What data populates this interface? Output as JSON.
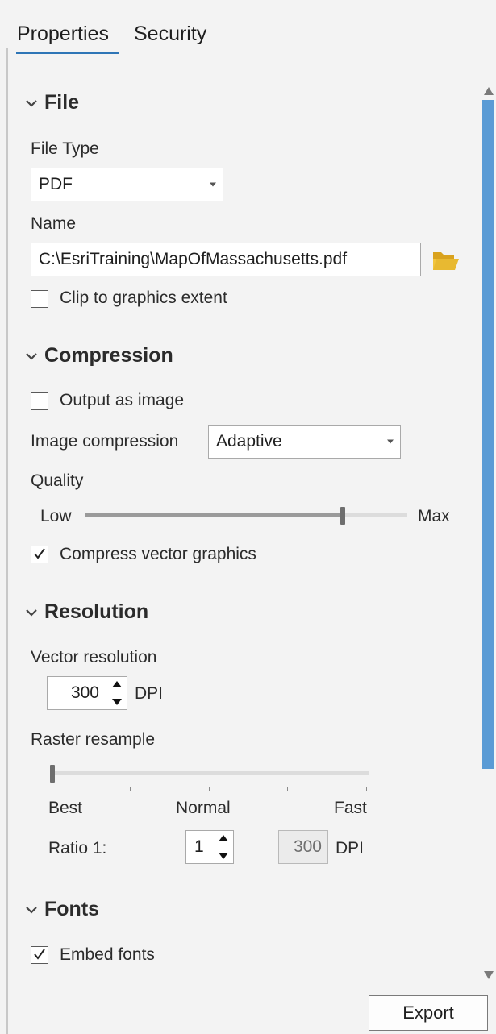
{
  "tabs": [
    {
      "label": "Properties",
      "active": true
    },
    {
      "label": "Security",
      "active": false
    }
  ],
  "sections": {
    "file": {
      "title": "File",
      "file_type_label": "File Type",
      "file_type_value": "PDF",
      "name_label": "Name",
      "name_value": "C:\\EsriTraining\\MapOfMassachusetts.pdf",
      "clip_label": "Clip to graphics extent",
      "clip_checked": false
    },
    "compression": {
      "title": "Compression",
      "output_image_label": "Output as image",
      "output_image_checked": false,
      "image_compression_label": "Image compression",
      "image_compression_value": "Adaptive",
      "quality_label": "Quality",
      "quality_low": "Low",
      "quality_max": "Max",
      "quality_level_fraction": 0.8,
      "compress_vector_label": "Compress vector graphics",
      "compress_vector_checked": true
    },
    "resolution": {
      "title": "Resolution",
      "vector_res_label": "Vector resolution",
      "vector_res_value": "300",
      "dpi_unit": "DPI",
      "raster_label": "Raster resample",
      "raster_best": "Best",
      "raster_normal": "Normal",
      "raster_fast": "Fast",
      "raster_level_fraction": 0.0,
      "ratio_label": "Ratio 1:",
      "ratio_value": "1",
      "ratio_dpi_value": "300",
      "ratio_dpi_unit": "DPI"
    },
    "fonts": {
      "title": "Fonts",
      "embed_label": "Embed fonts",
      "embed_checked": true
    }
  },
  "footer": {
    "export_label": "Export"
  },
  "colors": {
    "accent": "#2e75b6",
    "scroll_thumb": "#5a9bd5",
    "folder": "#e8b931"
  },
  "icons": [
    "chevron-down-icon",
    "dropdown-arrow-icon",
    "folder-open-icon",
    "checkmark-icon",
    "spin-up-icon",
    "spin-down-icon",
    "scroll-up-arrow-icon",
    "scroll-down-arrow-icon"
  ]
}
